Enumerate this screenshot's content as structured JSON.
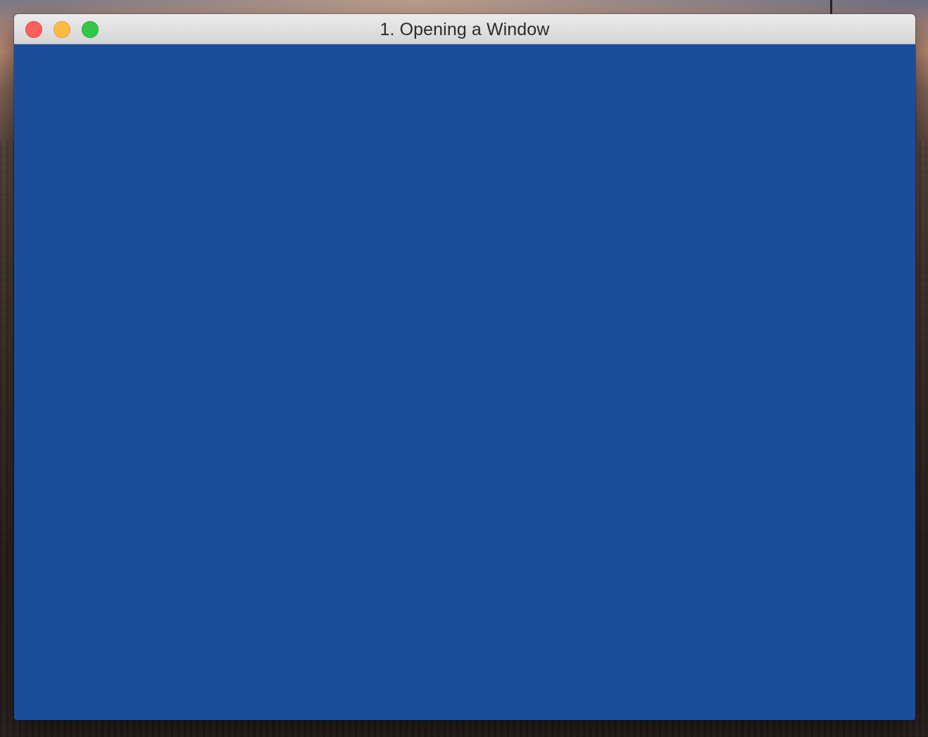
{
  "window": {
    "title": "1. Opening a Window",
    "clear_color": "#1c4d9a",
    "controls": {
      "close": "close-button",
      "minimize": "minimize-button",
      "zoom": "zoom-button"
    }
  },
  "colors": {
    "close": "#fc605c",
    "minimize": "#fdbc40",
    "zoom": "#34c84a",
    "titlebar": "#e0e0e0",
    "title_text": "#2b2b2b",
    "canvas": "#1c4d9a"
  }
}
